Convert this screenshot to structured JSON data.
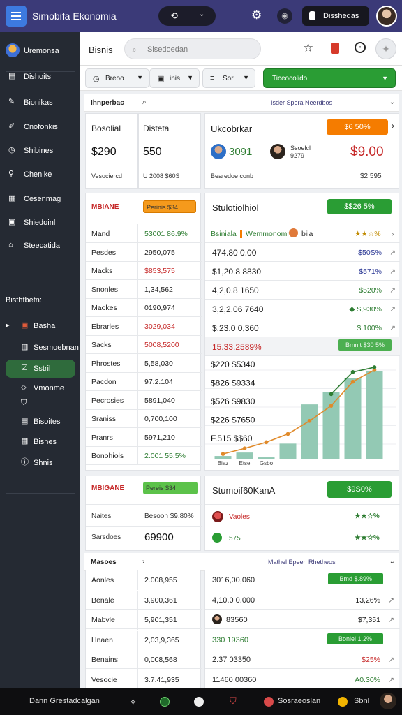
{
  "app": {
    "title": "Simobifa Ekonomia"
  },
  "topbar": {
    "pill_icon": "⟲",
    "pill_chevron": "⌄",
    "button_label": "Disshedas"
  },
  "header": {
    "title": "Bisnis",
    "search_placeholder": "Sisedoedan"
  },
  "sidebar": {
    "profile": "Uremonsa",
    "items": [
      "Dishoits",
      "Bionikas",
      "Cnofonkis",
      "Shibines",
      "Chenike",
      "Cesenmag",
      "Shiedoinl",
      "Steecatida"
    ],
    "section_title": "Bisthtbetn:",
    "sub_items": [
      "Basha",
      "Sesmoebnan",
      "Sstril",
      "Vmonme",
      "",
      "Bisoites",
      "Bisnes",
      "Shnis"
    ]
  },
  "filters": {
    "f1": "Breoo",
    "f2": "inis",
    "f3": "Sor",
    "green": "Ticeocolido"
  },
  "crumb": {
    "left": "Ihnperbac",
    "right": "Isder Spera Neerdbos"
  },
  "summary": {
    "col1_title": "Bosolial",
    "col1_value": "$290",
    "col1_foot": "Vesociercd",
    "col2_title": "Disteta",
    "col2_value": "550",
    "col2_foot": "U 2008 $60S",
    "col3_title": "Ukcobrkar",
    "col3_badge": "$6 50%",
    "col3_num": "3091",
    "col3_name": "Ssoelcl",
    "col3_sub": "9279",
    "col3_value": "$9.00",
    "col3_foot_l": "Bearedoe conb",
    "col3_foot_r": "$2,595"
  },
  "left_table": {
    "title": "MBIANE",
    "badge": "Perinis $34",
    "rows": [
      {
        "label": "Mand",
        "value": "53001 86.9%",
        "color": "green"
      },
      {
        "label": "Pesdes",
        "value": "2950,075",
        "color": "dark"
      },
      {
        "label": "Macks",
        "value": "$853,575",
        "color": "red"
      },
      {
        "label": "Snonles",
        "value": "1,34,562",
        "color": "dark"
      },
      {
        "label": "Maokes",
        "value": "0190,974",
        "color": "dark"
      },
      {
        "label": "Ebrarles",
        "value": "3029,034",
        "color": "red"
      },
      {
        "label": "Sacks",
        "value": "5008,5200",
        "color": "red"
      },
      {
        "label": "Phrostes",
        "value": "5,58,030",
        "color": "dark"
      },
      {
        "label": "Pacdon",
        "value": "97.2.104",
        "color": "dark"
      },
      {
        "label": "Pecrosies",
        "value": "5891,040",
        "color": "dark"
      },
      {
        "label": "Sraniss",
        "value": "0,700,100",
        "color": "dark"
      },
      {
        "label": "Pranrs",
        "value": "5971,210",
        "color": "dark"
      },
      {
        "label": "Bonohiols",
        "value": "2.001 55.5%",
        "color": "green"
      }
    ]
  },
  "right_table": {
    "title": "Stulotiolhiol",
    "badge": "$$26 5%",
    "header_a": "Bsiniala",
    "header_b": "Wemmonomnt",
    "header_c": "biia",
    "header_stars": "★★☆%",
    "rows": [
      {
        "value": "474.80 0.00",
        "pct": "$50S%",
        "color": "blue"
      },
      {
        "value": "$1,20.8 8830",
        "pct": "$571%",
        "color": "blue"
      },
      {
        "value": "4,2,0.8 1650",
        "pct": "$520%",
        "color": "green"
      },
      {
        "value": "3,2,2.06 7640",
        "pct": "◆ $,930%",
        "color": "green"
      },
      {
        "value": "$,23.0 0,360",
        "pct": "$.100%",
        "color": "green"
      },
      {
        "value": "15.33.2589%",
        "pct": "Bmnit $30 5%",
        "color": "red"
      }
    ]
  },
  "chart_data": {
    "type": "bar",
    "categories": [
      "Biaz",
      "Etse",
      "Gsbo",
      "",
      "",
      "",
      "",
      ""
    ],
    "values": [
      0.5,
      1.0,
      0.3,
      2.3,
      8.0,
      9.8,
      11.8,
      12.8
    ],
    "series": [
      {
        "name": "line-orange",
        "values": [
          0.8,
          1.6,
          2.5,
          3.7,
          5.6,
          7.8,
          11.3,
          13.0
        ]
      },
      {
        "name": "line-green",
        "values": [
          null,
          null,
          null,
          null,
          null,
          9.5,
          12.7,
          13.4
        ]
      }
    ],
    "y_tick_labels": [
      "$220 $5340",
      "$826 $9334",
      "$526 $9830",
      "$226 $7650",
      "F.515 $$60"
    ],
    "ylim": [
      0,
      14
    ],
    "colors": {
      "bars": "#93c9b4",
      "line1": "#e08a2a",
      "line2": "#2e7d32"
    }
  },
  "mid": {
    "left_title": "MBIGANE",
    "left_badge": "Pereis $34",
    "left_r1_label": "Naites",
    "left_r1_value": "Besoon $9.80%",
    "left_r2_label": "Sarsdoes",
    "left_r2_value": "69900",
    "right_title": "Stumoif60KanA",
    "right_badge": "$9S0%",
    "right_r1": "Vaoles",
    "right_r1_stars": "★★☆%",
    "right_r2": "575",
    "right_r2_stars": "★★☆%"
  },
  "lower": {
    "crumb_left": "Masoes",
    "crumb_right": "Mathel Epeen Rhetheos",
    "rows": [
      {
        "label": "Aonles",
        "v1": "2.008,955",
        "v2": "3016,00,060",
        "badge": "Bmd $.89%",
        "pct": "",
        "pct_color": "dark"
      },
      {
        "label": "Benale",
        "v1": "3,900,361",
        "v2": "4,10.0 0.000",
        "badge": "",
        "pct": "13,26%",
        "pct_color": "dark"
      },
      {
        "label": "Mabvle",
        "v1": "5,901,351",
        "v2": "83560",
        "badge": "",
        "pct": "$7,351",
        "pct_color": "dark"
      },
      {
        "label": "Hnaen",
        "v1": "2,03,9,365",
        "v2": "330 19360",
        "badge": "Boniel 1.2%",
        "pct": "",
        "pct_color": "dark"
      },
      {
        "label": "Benains",
        "v1": "0,008,568",
        "v2": "2.37 03350",
        "badge": "",
        "pct": "$25%",
        "pct_color": "red"
      },
      {
        "label": "Vesocie",
        "v1": "3.7.41,935",
        "v2": "11460 00360",
        "badge": "",
        "pct": "A0.30%",
        "pct_color": "green"
      }
    ]
  },
  "bottombar": {
    "left": "Dann Grestadcalgan",
    "right_a": "Sosraeoslan",
    "right_b": "Sbnl"
  }
}
